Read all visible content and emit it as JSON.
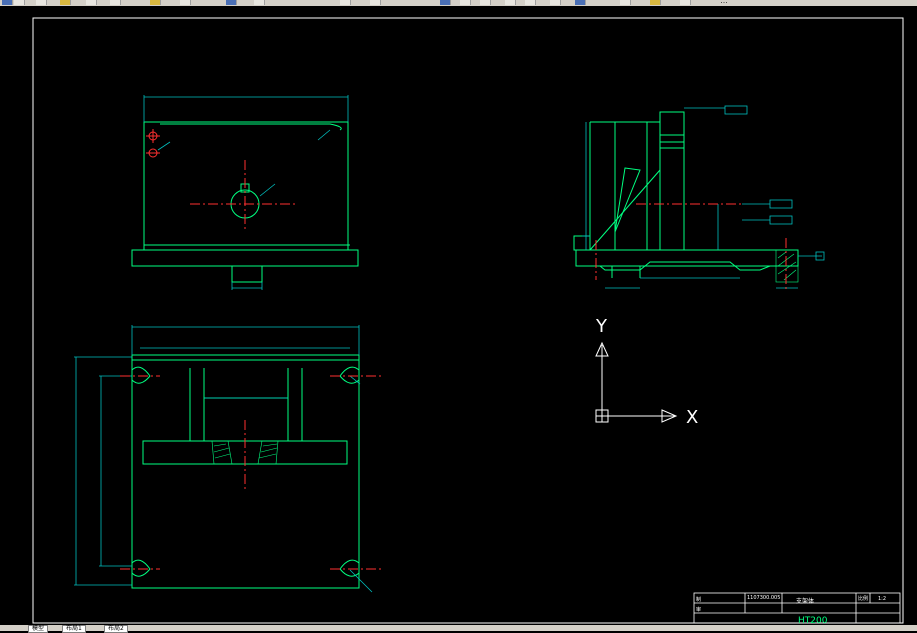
{
  "toolbar": {
    "label": "…",
    "buttons": [
      "new-icon",
      "open-icon",
      "save-icon",
      "print-icon",
      "undo-icon",
      "redo-icon",
      "pan-icon",
      "zoom-icon",
      "properties-icon",
      "layer-icon"
    ]
  },
  "ucs": {
    "x_label": "X",
    "y_label": "Y"
  },
  "title_block": {
    "drawing_number": "1107300.005",
    "part_name": "支架体",
    "material": "HT200",
    "row1_label": "制",
    "row2_label": "审",
    "scale_label": "比例",
    "scale_value": "1:2"
  },
  "tabs": {
    "model": "模型",
    "layout1": "布局1",
    "layout2": "布局2"
  },
  "colors": {
    "outline": "#00ff80",
    "dimension": "#00c0c0",
    "center": "#ff3030",
    "frame": "#ffffff"
  }
}
